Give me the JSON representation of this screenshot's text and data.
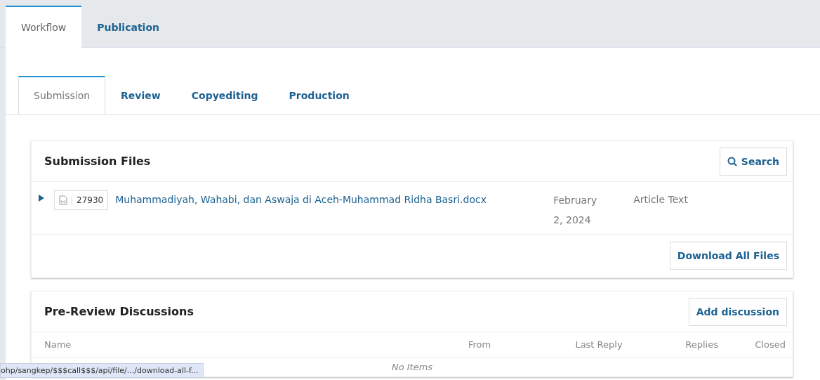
{
  "tabs": [
    {
      "label": "Workflow",
      "selected": true
    },
    {
      "label": "Publication",
      "selected": false
    }
  ],
  "stage_tabs": [
    {
      "label": "Submission",
      "selected": true
    },
    {
      "label": "Review",
      "selected": false
    },
    {
      "label": "Copyediting",
      "selected": false
    },
    {
      "label": "Production",
      "selected": false
    }
  ],
  "submission_files": {
    "title": "Submission Files",
    "search_button": "Search",
    "files": [
      {
        "expanded": false,
        "id": "27930",
        "name": "Muhammadiyah, Wahabi, dan Aswaja di Aceh-Muhammad Ridha Basri.docx",
        "date": "February 2, 2024",
        "type": "Article Text"
      }
    ],
    "download_button": "Download All Files"
  },
  "discussions": {
    "title": "Pre-Review Discussions",
    "add_button": "Add discussion",
    "columns": [
      "Name",
      "From",
      "Last Reply",
      "Replies",
      "Closed"
    ],
    "empty_text": "No Items"
  },
  "status_url": "ohp/sangkep/$$$call$$$/api/file/.../download-all-f..."
}
